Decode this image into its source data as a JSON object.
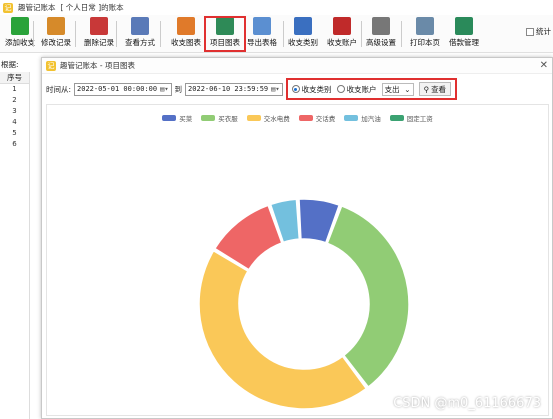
{
  "window": {
    "title": "趣管记账本",
    "subtitle": "[ 个人日常 ]的账本"
  },
  "toolbar": [
    {
      "id": "add",
      "label": "添加收支",
      "icon": "plus-icon",
      "color": "#2aa33a"
    },
    {
      "id": "edit",
      "label": "修改记录",
      "icon": "pencil-icon",
      "color": "#d68a2a"
    },
    {
      "id": "delete",
      "label": "删除记录",
      "icon": "delete-icon",
      "color": "#c83838"
    },
    {
      "id": "view",
      "label": "查看方式",
      "icon": "view-icon",
      "color": "#5a7ab8"
    },
    {
      "id": "chart",
      "label": "收支图表",
      "icon": "bar-chart-icon",
      "color": "#e07a2a"
    },
    {
      "id": "project_chart",
      "label": "项目图表",
      "icon": "project-chart-icon",
      "color": "#2e8a57"
    },
    {
      "id": "export",
      "label": "导出表格",
      "icon": "export-icon",
      "color": "#5b8fd1"
    },
    {
      "id": "category",
      "label": "收支类别",
      "icon": "category-icon",
      "color": "#3a6fc0"
    },
    {
      "id": "account",
      "label": "收支账户",
      "icon": "book-icon",
      "color": "#c02a2a"
    },
    {
      "id": "advanced",
      "label": "高级设置",
      "icon": "gear-icon",
      "color": "#777777"
    },
    {
      "id": "print",
      "label": "打印本页",
      "icon": "printer-icon",
      "color": "#6a8aa8"
    },
    {
      "id": "budget",
      "label": "借款管理",
      "icon": "network-icon",
      "color": "#2a8a5a"
    }
  ],
  "stat_label": "统计",
  "left": {
    "label": "根据:",
    "col": "序号",
    "rows": [
      "1",
      "2",
      "3",
      "4",
      "5",
      "6"
    ]
  },
  "dialog": {
    "title": "趣管记账本 - 项目图表",
    "close": "✕",
    "from_label": "时间从:",
    "from_value": "2022-05-01 00:00:00",
    "to_label": "到",
    "to_value": "2022-06-10 23:59:59",
    "radio1": "收支类别",
    "radio2": "收支账户",
    "select_value": "支出",
    "view_btn": "查看"
  },
  "chart_data": {
    "type": "pie",
    "style": "donut",
    "categories": [
      "买菜",
      "买衣服",
      "交水电费",
      "交话费",
      "加汽油",
      "固定工资"
    ],
    "values": [
      6,
      31,
      40,
      10,
      4,
      0
    ],
    "colors": [
      "#5470c6",
      "#91cc75",
      "#fac858",
      "#ee6666",
      "#73c0de",
      "#3ba272"
    ]
  },
  "watermark": "CSDN @m0_61166673"
}
